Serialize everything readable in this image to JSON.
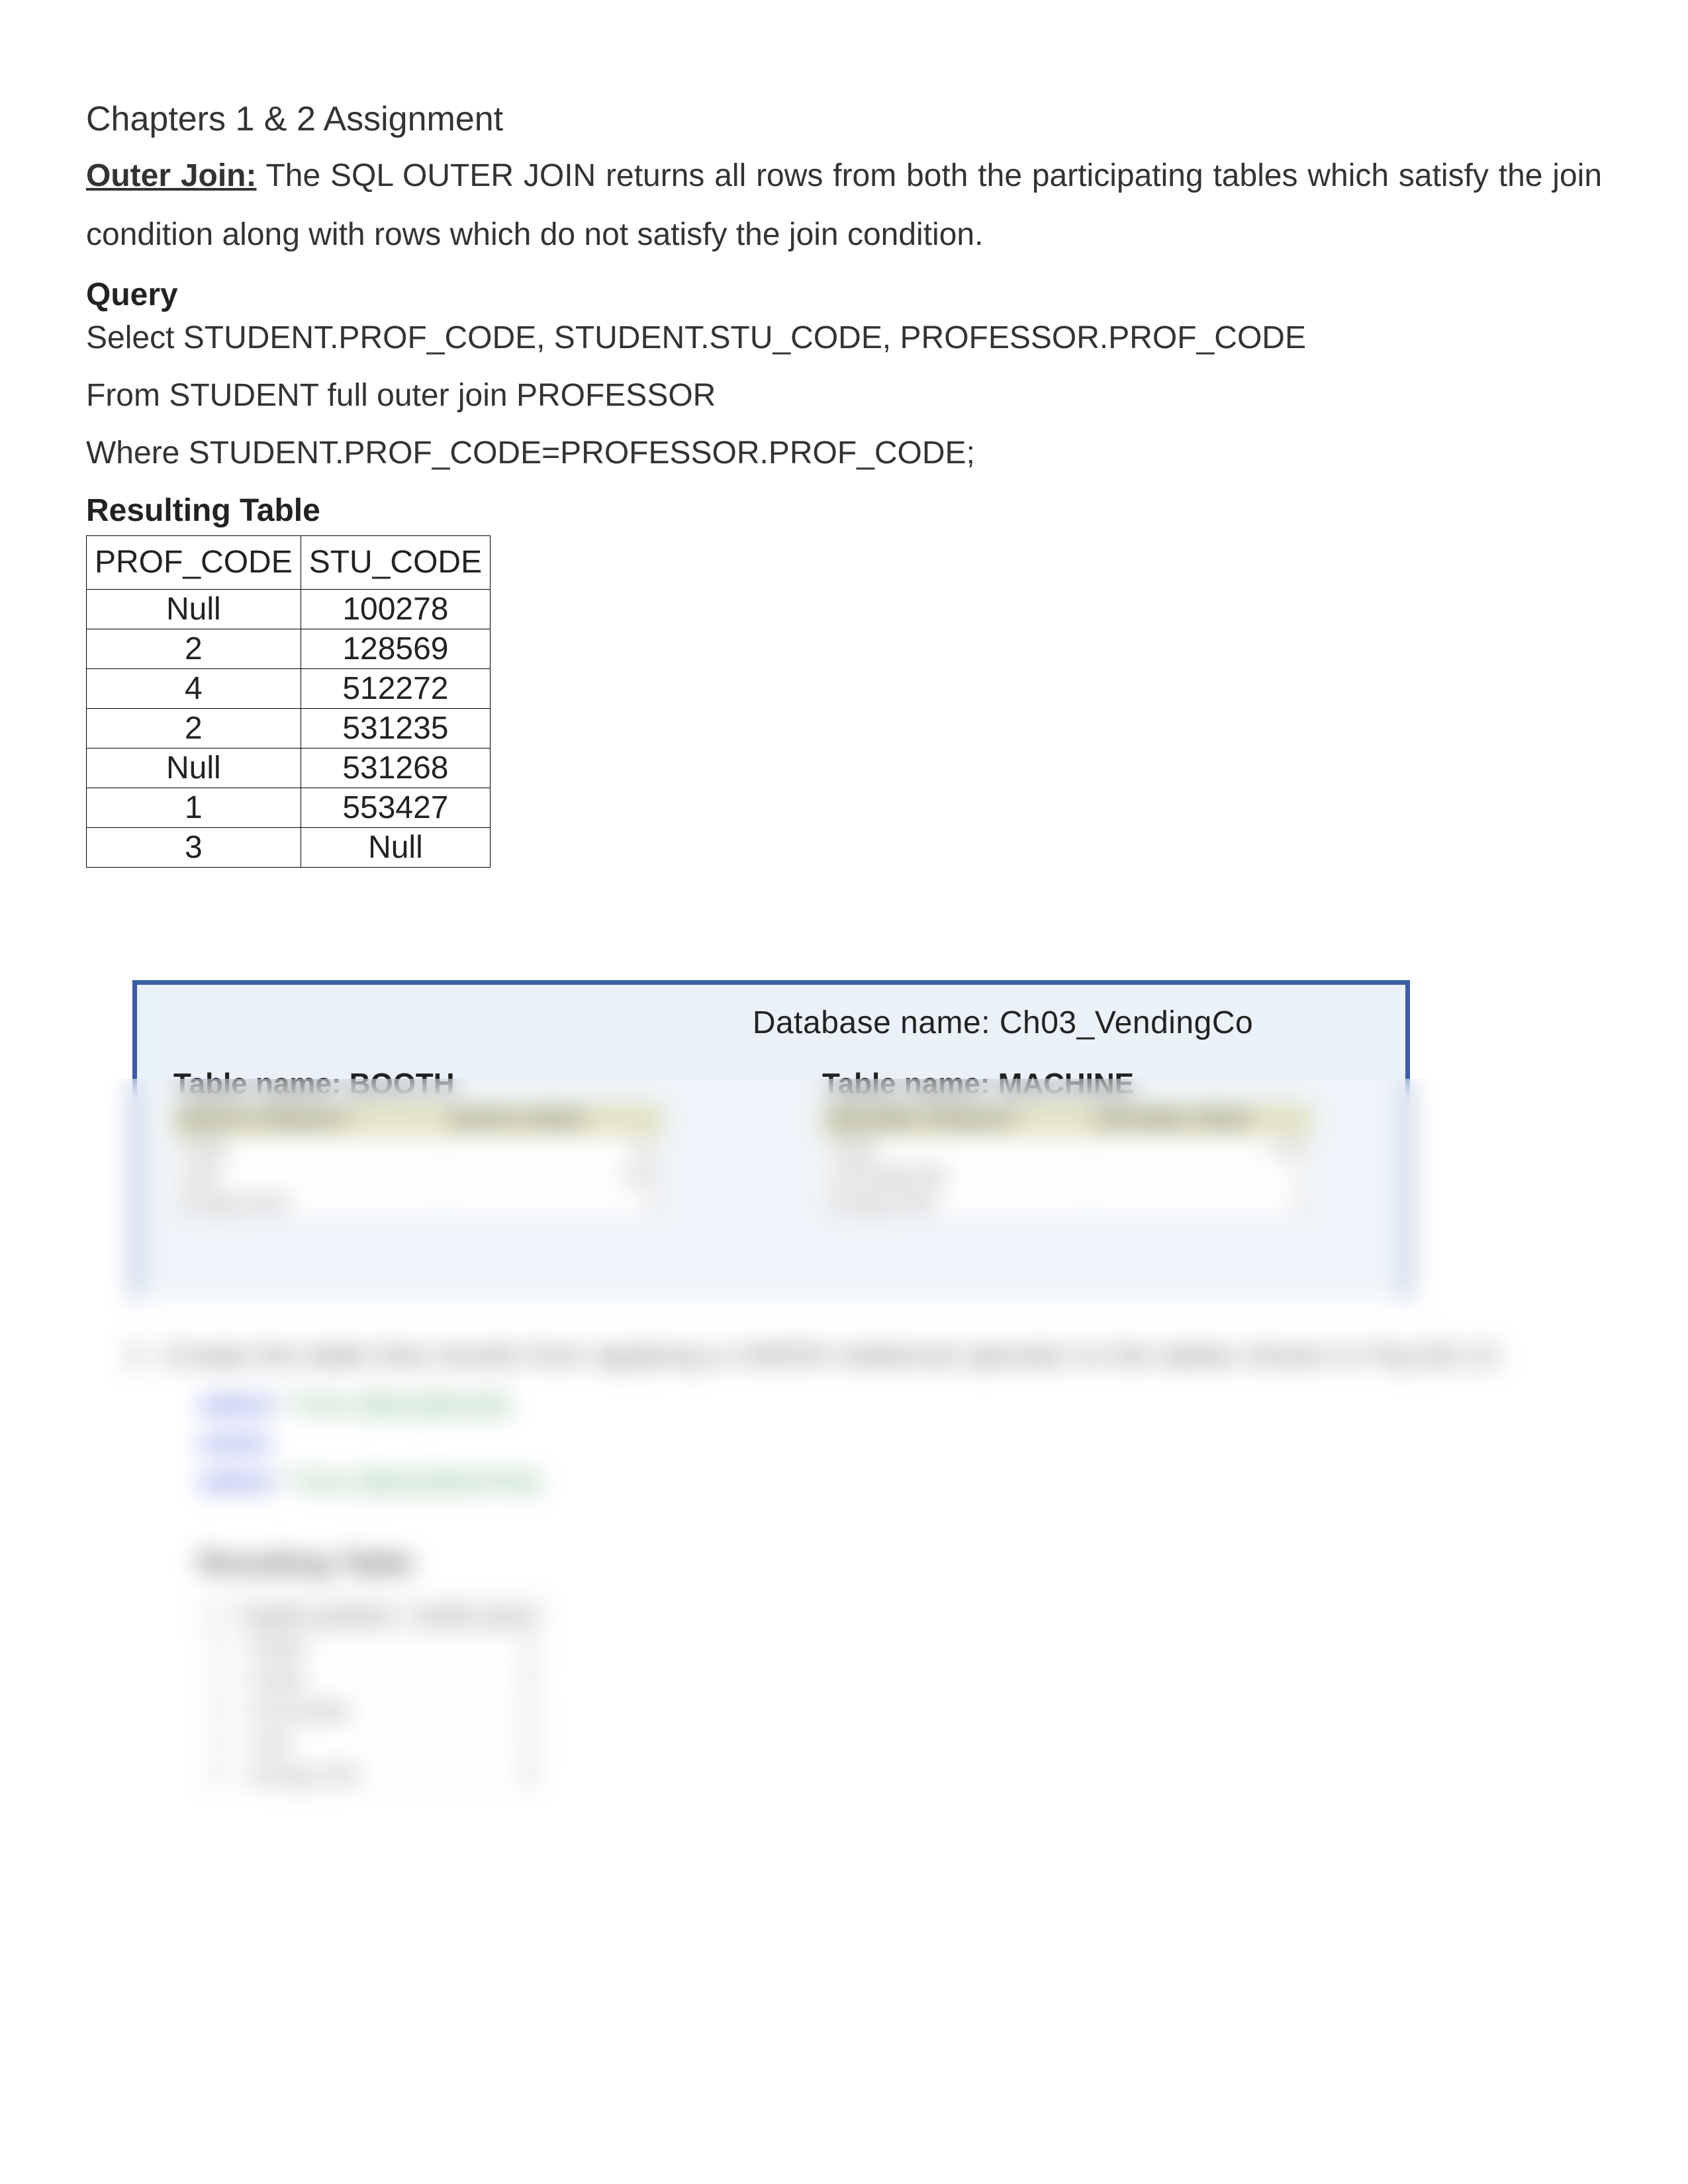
{
  "title": "Chapters 1 & 2 Assignment",
  "outer_join": {
    "term": "Outer Join:",
    "desc": "The SQL OUTER JOIN returns all rows from both the participating tables which satisfy the join condition along with rows which do not satisfy the join condition."
  },
  "query": {
    "label": "Query",
    "line1": "Select  STUDENT.PROF_CODE, STUDENT.STU_CODE, PROFESSOR.PROF_CODE",
    "line2": "From STUDENT full outer join PROFESSOR",
    "line3": "Where STUDENT.PROF_CODE=PROFESSOR.PROF_CODE;"
  },
  "result": {
    "label": "Resulting Table",
    "headers": [
      "PROF_CODE",
      "STU_CODE"
    ],
    "rows": [
      [
        "Null",
        "100278"
      ],
      [
        "2",
        "128569"
      ],
      [
        "4",
        "512272"
      ],
      [
        "2",
        "531235"
      ],
      [
        "Null",
        "531268"
      ],
      [
        "1",
        "553427"
      ],
      [
        "3",
        "Null"
      ]
    ]
  },
  "db": {
    "name": "Database name: Ch03_VendingCo",
    "booth": {
      "title": "Table name: BOOTH",
      "cols": [
        "BOOTH_PRODUCT",
        "BOOTH_PRICE"
      ],
      "rows": [
        [
          "Chips",
          "1.5"
        ],
        [
          "Cola",
          "1.25"
        ],
        [
          "Energy Drink",
          "2"
        ]
      ]
    },
    "machine": {
      "title": "Table name: MACHINE",
      "cols": [
        "MACHINE_PRODUCT",
        "MACHINE_PRICE"
      ],
      "rows": [
        [
          "Chips",
          "1.25"
        ],
        [
          "Chocolate Bar",
          "1"
        ],
        [
          "Energy Drink",
          "2"
        ]
      ]
    }
  },
  "q2": {
    "num": "2.",
    "text": "Create the table that results from applying a UNION relational operator to the tables shown in Fig Q3.12.",
    "sql": {
      "l1a": "select",
      "l1b": "* from [dbo].[Booth]",
      "l2": "union",
      "l3a": "select",
      "l3b": "* from [dbo].[Machine]"
    },
    "label": "Resulting Table",
    "cols": [
      "",
      "booth_product",
      "booth_price"
    ],
    "rows": [
      [
        "1",
        "Chips",
        "1"
      ],
      [
        "2",
        "Chips",
        "2"
      ],
      [
        "3",
        "Chocolate",
        "1"
      ],
      [
        "4",
        "cola",
        "1"
      ],
      [
        "5",
        "energy drin",
        "2"
      ]
    ]
  }
}
